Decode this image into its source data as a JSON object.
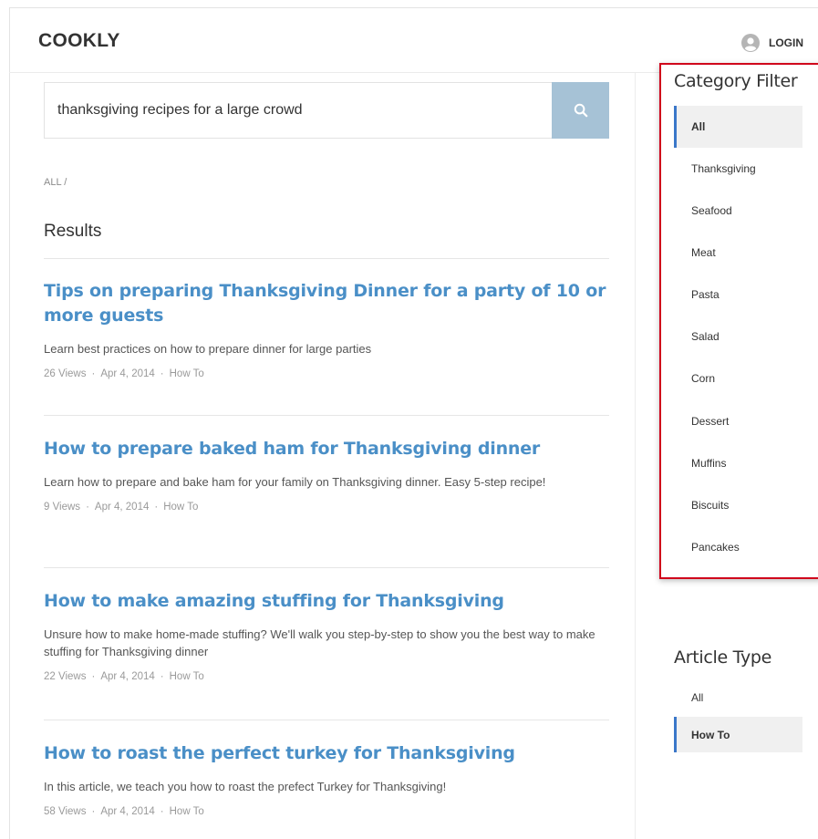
{
  "header": {
    "logo": "COOKLY",
    "login_label": "LOGIN"
  },
  "search": {
    "value": "thanksgiving recipes for a large crowd",
    "placeholder": ""
  },
  "breadcrumb": "ALL  /",
  "results_title": "Results",
  "results": [
    {
      "title": "Tips on preparing Thanksgiving Dinner for a party of 10 or more guests",
      "description": "Learn best practices on how to prepare dinner for large parties",
      "views": "26 Views",
      "date": "Apr 4, 2014",
      "type": "How To"
    },
    {
      "title": "How to prepare baked ham for Thanksgiving dinner",
      "description": "Learn how to prepare and bake ham for your family on Thanksgiving dinner. Easy 5-step recipe!",
      "views": "9 Views",
      "date": "Apr 4, 2014",
      "type": "How To"
    },
    {
      "title": "How to make amazing stuffing for Thanksgiving",
      "description": "Unsure how to make home-made stuffing? We'll walk you step-by-step to show you the best way to make stuffing for Thanksgiving dinner",
      "views": "22 Views",
      "date": "Apr 4, 2014",
      "type": "How To"
    },
    {
      "title": "How to roast the perfect turkey for Thanksgiving",
      "description": "In this article, we teach you how to roast the prefect Turkey for Thanksgiving!",
      "views": "58 Views",
      "date": "Apr 4, 2014",
      "type": "How To"
    }
  ],
  "meta_separator": "·",
  "category_filter": {
    "title": "Category Filter",
    "items": [
      "All",
      "Thanksgiving",
      "Seafood",
      "Meat",
      "Pasta",
      "Salad",
      "Corn",
      "Dessert",
      "Muffins",
      "Biscuits",
      "Pancakes"
    ],
    "active": "All"
  },
  "article_type": {
    "title": "Article Type",
    "items": [
      "All",
      "How To"
    ],
    "active": "How To"
  },
  "colors": {
    "accent_link": "#4a8fc7",
    "search_button": "#a6c2d6",
    "highlight_border": "#d0021b",
    "active_bar": "#3b77c9"
  },
  "icons": {
    "search": "search-icon",
    "user": "user-avatar-icon"
  }
}
